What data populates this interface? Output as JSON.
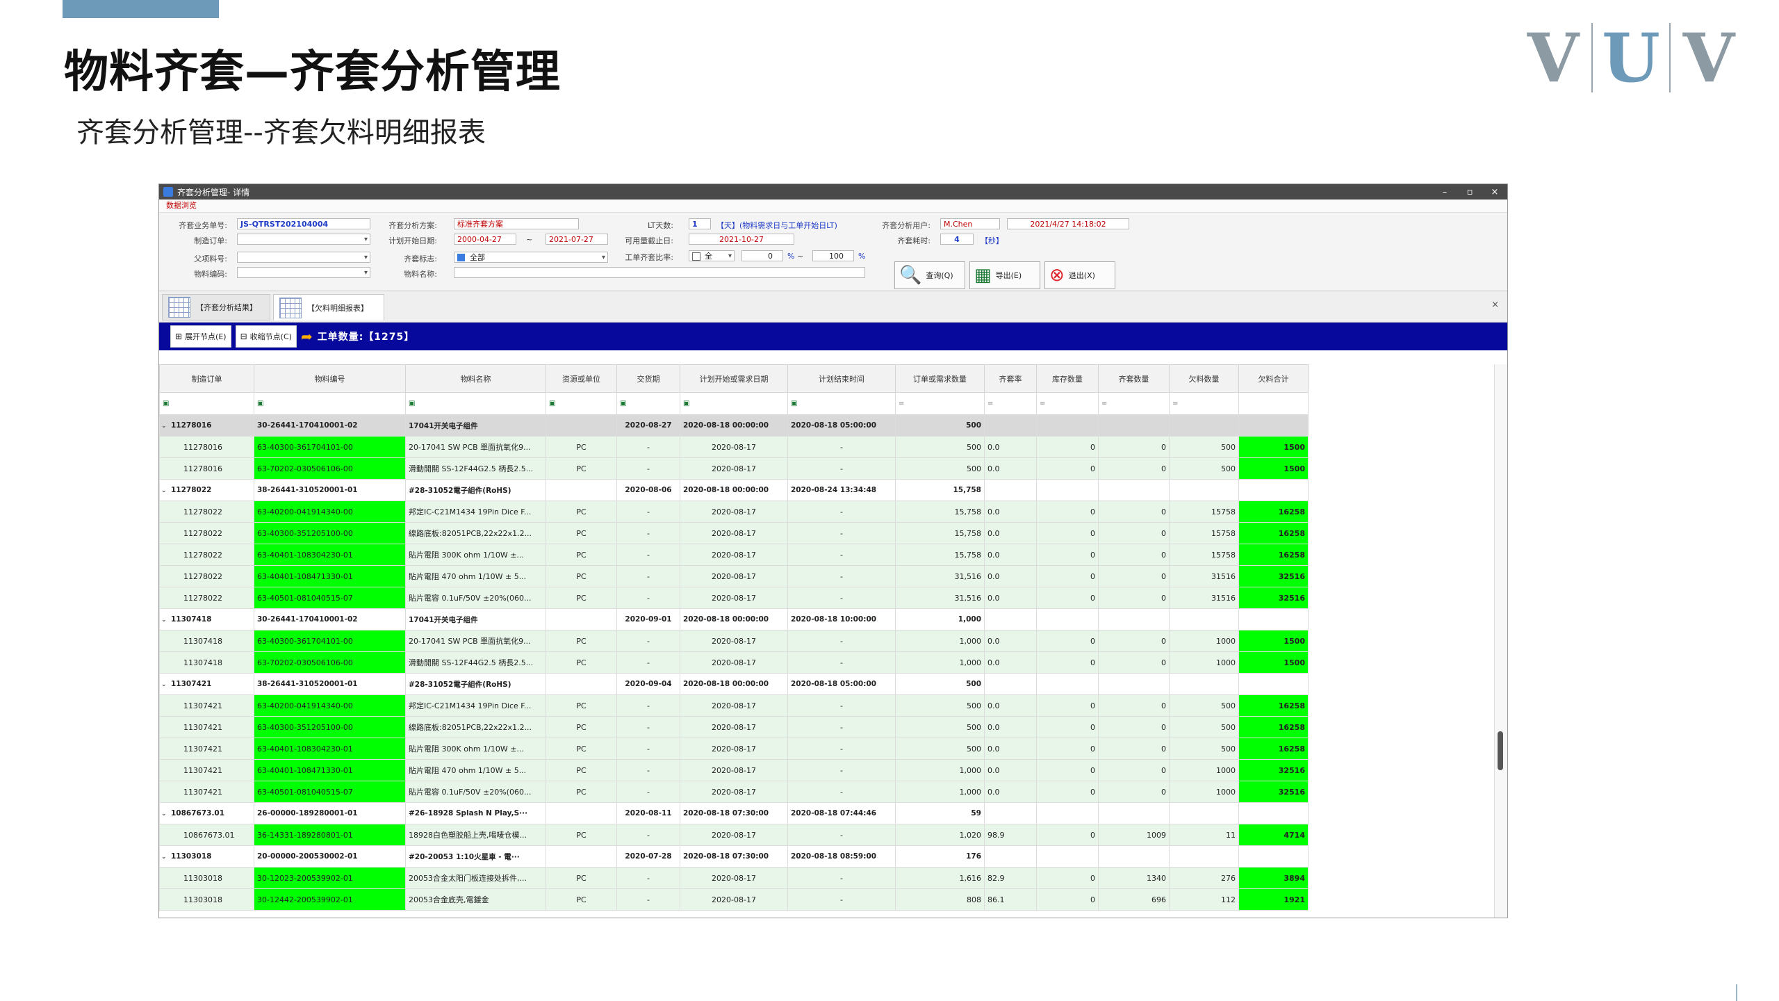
{
  "slide": {
    "title": "物料齐套—齐套分析管理",
    "subtitle": "齐套分析管理--齐套欠料明细报表",
    "logo": {
      "l1": "V",
      "l2": "U",
      "l3": "V"
    }
  },
  "window": {
    "title": "齐套分析管理- 详情",
    "menu": "数据浏览",
    "controls": {
      "min": "–",
      "restore": "▫",
      "close": "×"
    }
  },
  "form": {
    "labels": {
      "biz_no": "齐套业务单号:",
      "mfg_order": "制造订单:",
      "parent_item": "父项料号:",
      "item_code": "物料编码:",
      "plan": "齐套分析方案:",
      "plan_start": "计划开始日期:",
      "kit_flag": "齐套标志:",
      "item_name": "物料名称:",
      "lt_days": "LT天数:",
      "avail_cutoff": "可用量截止日:",
      "order_ratio": "工单齐套比率:",
      "user": "齐套分析用户:",
      "elapsed": "齐套耗时:"
    },
    "values": {
      "biz_no": "JS-QTRST202104004",
      "mfg_order": "",
      "parent_item": "",
      "item_code": "",
      "plan": "标准齐套方案",
      "plan_start_from": "2000-04-27",
      "range_sep": "~",
      "plan_start_to": "2021-07-27",
      "kit_flag": "全部",
      "item_name": "",
      "lt_days": "1",
      "lt_note": "【天】(物料需求日与工单开始日LT)",
      "avail_cutoff": "2021-10-27",
      "ratio_mode": "全",
      "ratio_from": "0",
      "ratio_pct": "%",
      "ratio_sep": "~",
      "ratio_to": "100",
      "ratio_pct2": "%",
      "user": "M.Chen",
      "run_time": "2021/4/27 14:18:02",
      "elapsed": "4",
      "elapsed_unit": "【秒】"
    },
    "buttons": {
      "query": "查询(Q)",
      "export": "导出(E)",
      "exit": "退出(X)"
    }
  },
  "tabs": [
    {
      "label": "【齐套分析结果】",
      "active": false
    },
    {
      "label": "【欠料明细报表】",
      "active": true
    }
  ],
  "tabs_close": "×",
  "toolbar": {
    "expand": "展开节点(E)",
    "collapse": "收缩节点(C)",
    "count_label": "工单数量:",
    "count": "【1275】"
  },
  "grid": {
    "columns": [
      "制造订单",
      "物料编号",
      "物料名称",
      "资源或单位",
      "交货期",
      "计划开始或需求日期",
      "计划结束时间",
      "订单或需求数量",
      "齐套率",
      "库存数量",
      "齐套数量",
      "欠料数量",
      "欠料合计"
    ],
    "filter_text": [
      "▣",
      "▣",
      "▣",
      "▣",
      "▣",
      "▣",
      "▣",
      "=",
      "=",
      "=",
      "=",
      "=",
      ""
    ],
    "rows": [
      {
        "type": "g",
        "sel": true,
        "c": [
          "11278016",
          "30-26441-170410001-02",
          "17041开关电子组件",
          "",
          "2020-08-27",
          "2020-08-18 00:00:00",
          "2020-08-18 05:00:00",
          "500",
          "",
          "",
          "",
          "",
          ""
        ]
      },
      {
        "type": "d",
        "c": [
          "11278016",
          "63-40300-361704101-00",
          "20-17041 SW PCB 單面抗氧化9...",
          "PC",
          "-",
          "2020-08-17",
          "-",
          "500",
          "0.0",
          "0",
          "0",
          "500",
          "1500"
        ]
      },
      {
        "type": "d",
        "c": [
          "11278016",
          "63-70202-030506106-00",
          "滑動開關 SS-12F44G2.5 柄長2.5...",
          "PC",
          "-",
          "2020-08-17",
          "-",
          "500",
          "0.0",
          "0",
          "0",
          "500",
          "1500"
        ]
      },
      {
        "type": "g",
        "c": [
          "11278022",
          "38-26441-310520001-01",
          "#28-31052電子組件(RoHS)",
          "",
          "2020-08-06",
          "2020-08-18 00:00:00",
          "2020-08-24 13:34:48",
          "15,758",
          "",
          "",
          "",
          "",
          ""
        ]
      },
      {
        "type": "d",
        "c": [
          "11278022",
          "63-40200-041914340-00",
          "邦定IC-C21M1434 19Pin Dice F...",
          "PC",
          "-",
          "2020-08-17",
          "-",
          "15,758",
          "0.0",
          "0",
          "0",
          "15758",
          "16258"
        ]
      },
      {
        "type": "d",
        "c": [
          "11278022",
          "63-40300-351205100-00",
          "線路底板:82051PCB,22x22x1.2...",
          "PC",
          "-",
          "2020-08-17",
          "-",
          "15,758",
          "0.0",
          "0",
          "0",
          "15758",
          "16258"
        ]
      },
      {
        "type": "d",
        "c": [
          "11278022",
          "63-40401-108304230-01",
          "貼片電阻 300K ohm 1/10W ±...",
          "PC",
          "-",
          "2020-08-17",
          "-",
          "15,758",
          "0.0",
          "0",
          "0",
          "15758",
          "16258"
        ]
      },
      {
        "type": "d",
        "c": [
          "11278022",
          "63-40401-108471330-01",
          "貼片電阻 470 ohm 1/10W ± 5...",
          "PC",
          "-",
          "2020-08-17",
          "-",
          "31,516",
          "0.0",
          "0",
          "0",
          "31516",
          "32516"
        ]
      },
      {
        "type": "d",
        "c": [
          "11278022",
          "63-40501-081040515-07",
          "貼片電容 0.1uF/50V ±20%(060...",
          "PC",
          "-",
          "2020-08-17",
          "-",
          "31,516",
          "0.0",
          "0",
          "0",
          "31516",
          "32516"
        ]
      },
      {
        "type": "g",
        "c": [
          "11307418",
          "30-26441-170410001-02",
          "17041开关电子组件",
          "",
          "2020-09-01",
          "2020-08-18 00:00:00",
          "2020-08-18 10:00:00",
          "1,000",
          "",
          "",
          "",
          "",
          ""
        ]
      },
      {
        "type": "d",
        "c": [
          "11307418",
          "63-40300-361704101-00",
          "20-17041 SW PCB 單面抗氧化9...",
          "PC",
          "-",
          "2020-08-17",
          "-",
          "1,000",
          "0.0",
          "0",
          "0",
          "1000",
          "1500"
        ]
      },
      {
        "type": "d",
        "c": [
          "11307418",
          "63-70202-030506106-00",
          "滑動開關 SS-12F44G2.5 柄長2.5...",
          "PC",
          "-",
          "2020-08-17",
          "-",
          "1,000",
          "0.0",
          "0",
          "0",
          "1000",
          "1500"
        ]
      },
      {
        "type": "g",
        "c": [
          "11307421",
          "38-26441-310520001-01",
          "#28-31052電子組件(RoHS)",
          "",
          "2020-09-04",
          "2020-08-18 00:00:00",
          "2020-08-18 05:00:00",
          "500",
          "",
          "",
          "",
          "",
          ""
        ]
      },
      {
        "type": "d",
        "c": [
          "11307421",
          "63-40200-041914340-00",
          "邦定IC-C21M1434 19Pin Dice F...",
          "PC",
          "-",
          "2020-08-17",
          "-",
          "500",
          "0.0",
          "0",
          "0",
          "500",
          "16258"
        ]
      },
      {
        "type": "d",
        "c": [
          "11307421",
          "63-40300-351205100-00",
          "線路底板:82051PCB,22x22x1.2...",
          "PC",
          "-",
          "2020-08-17",
          "-",
          "500",
          "0.0",
          "0",
          "0",
          "500",
          "16258"
        ]
      },
      {
        "type": "d",
        "c": [
          "11307421",
          "63-40401-108304230-01",
          "貼片電阻 300K ohm 1/10W ±...",
          "PC",
          "-",
          "2020-08-17",
          "-",
          "500",
          "0.0",
          "0",
          "0",
          "500",
          "16258"
        ]
      },
      {
        "type": "d",
        "c": [
          "11307421",
          "63-40401-108471330-01",
          "貼片電阻 470 ohm 1/10W ± 5...",
          "PC",
          "-",
          "2020-08-17",
          "-",
          "1,000",
          "0.0",
          "0",
          "0",
          "1000",
          "32516"
        ]
      },
      {
        "type": "d",
        "c": [
          "11307421",
          "63-40501-081040515-07",
          "貼片電容 0.1uF/50V ±20%(060...",
          "PC",
          "-",
          "2020-08-17",
          "-",
          "1,000",
          "0.0",
          "0",
          "0",
          "1000",
          "32516"
        ]
      },
      {
        "type": "g",
        "c": [
          "10867673.01",
          "26-00000-189280001-01",
          "#26-18928 Splash N Play,S···",
          "",
          "2020-08-11",
          "2020-08-18 07:30:00",
          "2020-08-18 07:44:46",
          "59",
          "",
          "",
          "",
          "",
          ""
        ]
      },
      {
        "type": "d",
        "c": [
          "10867673.01",
          "36-14331-189280801-01",
          "18928白色塑胶船上壳,喝唛仓模...",
          "PC",
          "-",
          "2020-08-17",
          "-",
          "1,020",
          "98.9",
          "0",
          "1009",
          "11",
          "4714"
        ]
      },
      {
        "type": "g",
        "c": [
          "11303018",
          "20-00000-200530002-01",
          "#20-20053 1:10火星車 - 電···",
          "",
          "2020-07-28",
          "2020-08-18 07:30:00",
          "2020-08-18 08:59:00",
          "176",
          "",
          "",
          "",
          "",
          ""
        ]
      },
      {
        "type": "d",
        "c": [
          "11303018",
          "30-12023-200539902-01",
          "20053合金太阳门板连接处拆件,...",
          "PC",
          "-",
          "2020-08-17",
          "-",
          "1,616",
          "82.9",
          "0",
          "1340",
          "276",
          "3894"
        ]
      },
      {
        "type": "d",
        "c": [
          "11303018",
          "30-12442-200539902-01",
          "20053合金底壳,電鍍金",
          "PC",
          "-",
          "2020-08-17",
          "-",
          "808",
          "86.1",
          "0",
          "696",
          "112",
          "1921"
        ]
      }
    ]
  }
}
